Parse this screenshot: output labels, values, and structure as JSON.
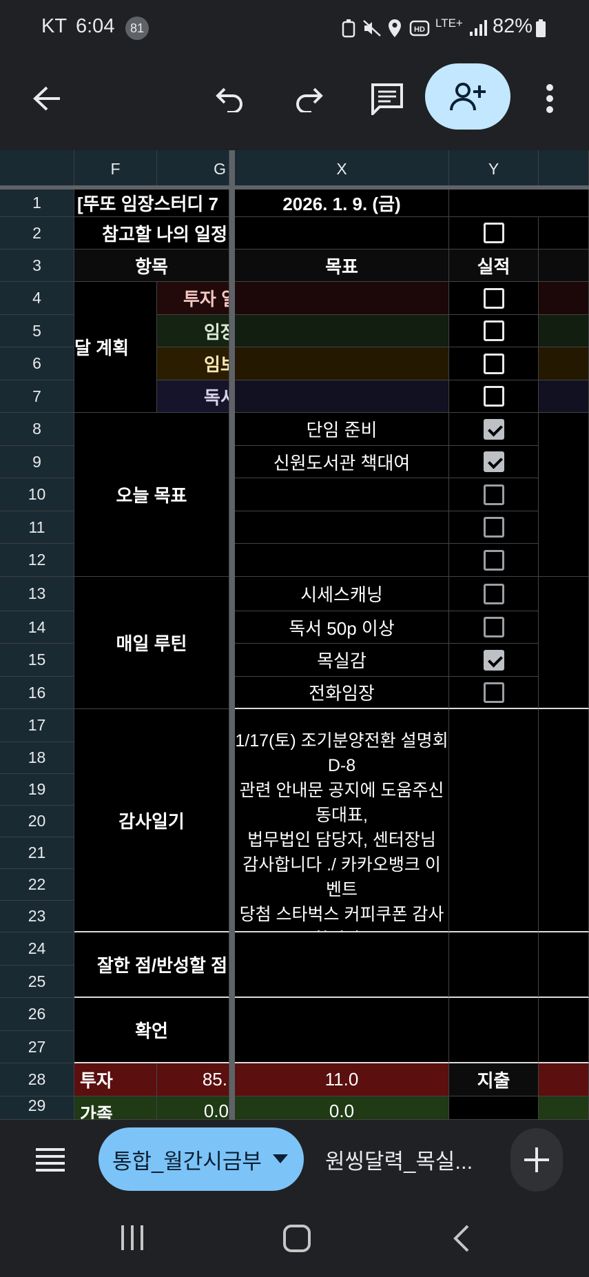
{
  "status": {
    "carrier": "KT",
    "time": "6:04",
    "badge": "81",
    "battery": "82%",
    "net": "LTE+"
  },
  "columns": [
    "F",
    "G",
    "X",
    "Y"
  ],
  "header_row1": {
    "title": "[뚜또 임장스터디 7",
    "date": "2026. 1. 9. (금)"
  },
  "rows": [
    {
      "n": "1"
    },
    {
      "n": "2"
    },
    {
      "n": "3"
    },
    {
      "n": "4"
    },
    {
      "n": "5"
    },
    {
      "n": "6"
    },
    {
      "n": "7"
    },
    {
      "n": "8"
    },
    {
      "n": "9"
    },
    {
      "n": "10"
    },
    {
      "n": "11"
    },
    {
      "n": "12"
    },
    {
      "n": "13"
    },
    {
      "n": "14"
    },
    {
      "n": "15"
    },
    {
      "n": "16"
    },
    {
      "n": "17"
    },
    {
      "n": "18"
    },
    {
      "n": "19"
    },
    {
      "n": "20"
    },
    {
      "n": "21"
    },
    {
      "n": "22"
    },
    {
      "n": "23"
    },
    {
      "n": "24"
    },
    {
      "n": "25"
    },
    {
      "n": "26"
    },
    {
      "n": "27"
    },
    {
      "n": "28"
    },
    {
      "n": "29"
    }
  ],
  "sheet": {
    "ref_schedule": "참고할 나의 일정",
    "item_label": "항목",
    "goal_label": "목표",
    "result_label": "실적",
    "monthly_plan": "달 계획",
    "plans": [
      "투자 일",
      "임장",
      "임보",
      "독서"
    ],
    "today_goals": "오늘 목표",
    "today_items": [
      "단임 준비",
      "신원도서관 책대여"
    ],
    "daily_routine": "매일 루틴",
    "routine_items": [
      "시세스캐닝",
      "독서 50p 이상",
      "목실감",
      "전화임장"
    ],
    "gratitude": "감사일기",
    "gratitude_text": "1/17(토) 조기분양전환 설명회 D-8\n관련 안내문 공지에 도움주신 동대표,\n법무법인 담당자, 센터장님\n감사합니다 ./ 카카오뱅크 이벤트\n당첨 스타벅스 커피쿠폰 감사합니다 /\n밀크티님 좋은 제안 주셔서\n감사해요~ /",
    "review": "잘한 점/반성할 점",
    "affirm": "확언",
    "invest": "투자",
    "invest_g": "85.",
    "invest_x": "11.0",
    "expense": "지출",
    "row29_f": "가족",
    "row29_g": "0.0",
    "row29_x": "0.0"
  },
  "tabs": {
    "active": "통합_월간시금부",
    "other": "원씽달력_목실..."
  }
}
